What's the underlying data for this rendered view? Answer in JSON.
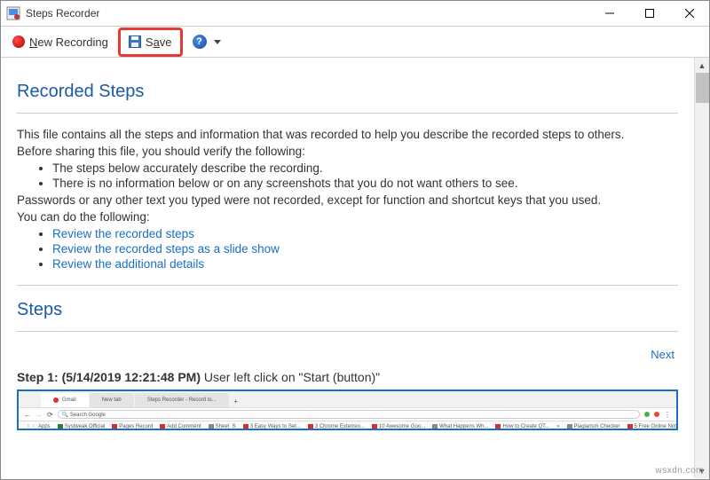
{
  "window": {
    "title": "Steps Recorder"
  },
  "toolbar": {
    "new_recording_label": "New Recording",
    "save_label": "Save",
    "help_symbol": "?"
  },
  "sections": {
    "recorded_steps_heading": "Recorded Steps",
    "steps_heading": "Steps"
  },
  "intro": {
    "line1": "This file contains all the steps and information that was recorded to help you describe the recorded steps to others.",
    "line2": "Before sharing this file, you should verify the following:",
    "bullet1": "The steps below accurately describe the recording.",
    "bullet2": "There is no information below or on any screenshots that you do not want others to see.",
    "line3": "Passwords or any other text you typed were not recorded, except for function and shortcut keys that you used.",
    "line4": "You can do the following:",
    "link1": "Review the recorded steps",
    "link2": "Review the recorded steps as a slide show",
    "link3": "Review the additional details"
  },
  "nav": {
    "next": "Next"
  },
  "step1": {
    "prefix": "Step 1:",
    "timestamp": "(5/14/2019 12:21:48 PM)",
    "action": " User left click on \"Start (button)\""
  },
  "watermark": "wsxdn.com"
}
